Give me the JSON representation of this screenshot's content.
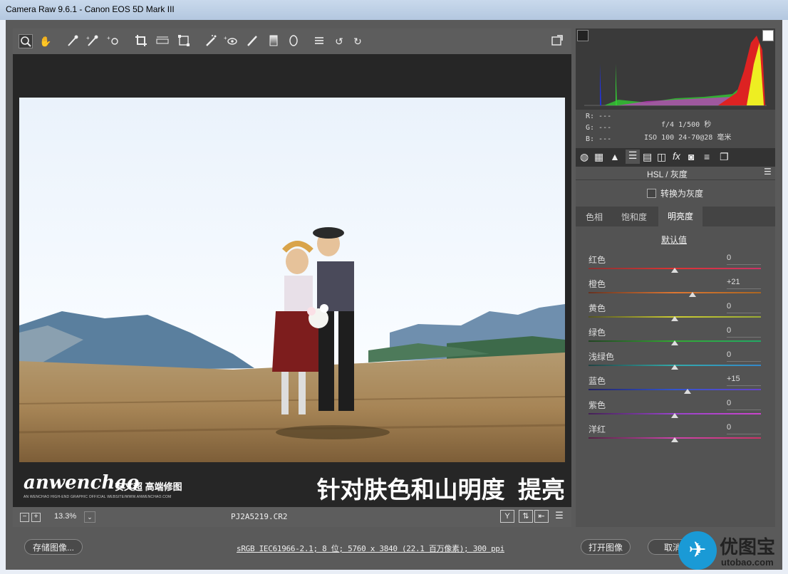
{
  "window": {
    "title": "Camera Raw 9.6.1 -  Canon EOS 5D Mark III"
  },
  "toolbar": {
    "tools": [
      "zoom-icon",
      "hand-icon",
      "white-balance-icon",
      "color-sampler-icon",
      "targeted-adjust-icon",
      "crop-icon",
      "straighten-icon",
      "transform-icon",
      "spot-removal-icon",
      "red-eye-icon",
      "adjustment-brush-icon",
      "graduated-filter-icon",
      "radial-filter-icon",
      "preferences-icon",
      "rotate-ccw-icon",
      "rotate-cw-icon"
    ],
    "fullscreen_icon": "fullscreen-icon"
  },
  "banner": {
    "logo": "anwenchao",
    "logo_cn": "安文超 高端修图",
    "logo_sub": "AN WENCHAO HIGH-END GRAPHIC OFFICIAL WEBSITE/WWW.ANWENCHAO.COM",
    "caption": "针对肤色和山明度  提亮"
  },
  "statusbar": {
    "zoom": "13.3%",
    "filename": "PJ2A5219.CR2",
    "minus": "−",
    "plus": "+"
  },
  "info": {
    "r": "R:  ---",
    "g": "G:  ---",
    "b": "B:  ---",
    "exposure": "f/4   1/500 秒",
    "lens": "ISO 100   24-70@28 毫米"
  },
  "panel": {
    "title": "HSL / 灰度",
    "convert_gray": "转换为灰度",
    "tabs": [
      "色相",
      "饱和度",
      "明亮度"
    ],
    "active_tab": 2,
    "default": "默认值",
    "sliders": [
      {
        "label": "红色",
        "value": "0",
        "pos": 0,
        "colors": [
          "#883333",
          "#dd3333",
          "#cc3366"
        ]
      },
      {
        "label": "橙色",
        "value": "+21",
        "pos": 21,
        "colors": [
          "#663322",
          "#dd7733",
          "#aa6622"
        ]
      },
      {
        "label": "黄色",
        "value": "0",
        "pos": 0,
        "colors": [
          "#555522",
          "#cccc33",
          "#99aa33"
        ]
      },
      {
        "label": "绿色",
        "value": "0",
        "pos": 0,
        "colors": [
          "#224422",
          "#33aa33",
          "#22aa66"
        ]
      },
      {
        "label": "浅绿色",
        "value": "0",
        "pos": 0,
        "colors": [
          "#224444",
          "#33aaaa",
          "#3388cc"
        ]
      },
      {
        "label": "蓝色",
        "value": "+15",
        "pos": 15,
        "colors": [
          "#222266",
          "#3355cc",
          "#6644cc"
        ]
      },
      {
        "label": "紫色",
        "value": "0",
        "pos": 0,
        "colors": [
          "#442255",
          "#9944cc",
          "#cc44cc"
        ]
      },
      {
        "label": "洋红",
        "value": "0",
        "pos": 0,
        "colors": [
          "#552244",
          "#cc44aa",
          "#cc3366"
        ]
      }
    ]
  },
  "footer": {
    "save": "存储图像...",
    "workflow": "sRGB IEC61966-2.1; 8 位; 5760 x 3840 (22.1 百万像素); 300 ppi",
    "open": "打开图像",
    "cancel": "取消",
    "watermark": "优图宝",
    "watermark_url": "utobao.com"
  }
}
